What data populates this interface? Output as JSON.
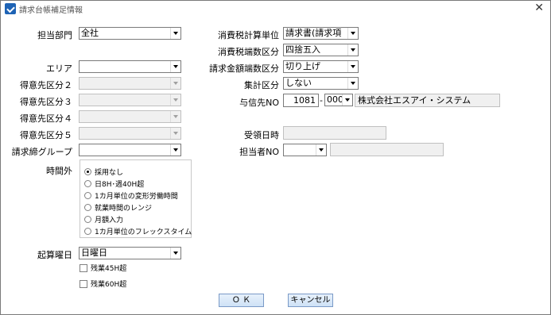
{
  "window": {
    "title": "請求台帳補足情報"
  },
  "left": {
    "tantou_bumon": {
      "label": "担当部門",
      "value": "全社"
    },
    "area": {
      "label": "エリア",
      "value": ""
    },
    "tokuisaki2": {
      "label": "得意先区分２",
      "value": ""
    },
    "tokuisaki3": {
      "label": "得意先区分３",
      "value": ""
    },
    "tokuisaki4": {
      "label": "得意先区分４",
      "value": ""
    },
    "tokuisaki5": {
      "label": "得意先区分５",
      "value": ""
    },
    "seikyu_group": {
      "label": "請求締グループ",
      "value": ""
    },
    "jikangai": {
      "label": "時間外",
      "options": [
        "採用なし",
        "日8H･週40H超",
        "1カ月単位の変形労働時間",
        "就業時間のレンジ",
        "月額入力",
        "1カ月単位のフレックスタイム"
      ],
      "selected_index": 0
    },
    "kisan_youbi": {
      "label": "起算曜日",
      "value": "日曜日"
    },
    "zangyo45": {
      "label": "残業45H超",
      "checked": false
    },
    "zangyo60": {
      "label": "残業60H超",
      "checked": false
    }
  },
  "right": {
    "shohizei_tani": {
      "label": "消費税計算単位",
      "value": "請求書(請求項"
    },
    "shohizei_hasu": {
      "label": "消費税端数区分",
      "value": "四捨五入"
    },
    "seikyu_hasu": {
      "label": "請求金額端数区分",
      "value": "切り上げ"
    },
    "shukei": {
      "label": "集計区分",
      "value": "しない"
    },
    "yoshinsaki": {
      "label": "与信先NO",
      "code": "1081",
      "separator": "-",
      "branch": "000",
      "name": "株式会社エスアイ・システム"
    },
    "juryo": {
      "label": "受領日時",
      "value": ""
    },
    "tantousha": {
      "label": "担当者NO",
      "value": "",
      "name": ""
    }
  },
  "buttons": {
    "ok": "Ｏ Ｋ",
    "cancel": "キャンセル"
  }
}
